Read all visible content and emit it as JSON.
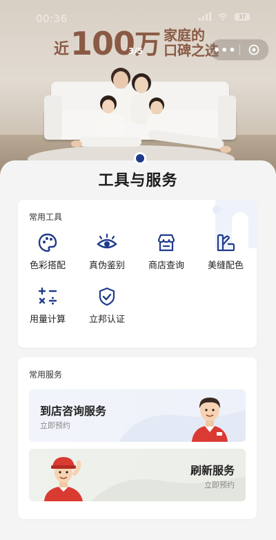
{
  "status_bar": {
    "time": "00:36",
    "battery": "37"
  },
  "banner": {
    "headline_prefix": "近",
    "headline_number": "100",
    "headline_unit": "万",
    "headline_line1": "家庭的",
    "headline_line2": "口碑之选",
    "pager": "3/5"
  },
  "page_title": "工具与服务",
  "tools_section": {
    "title": "常用工具",
    "items": [
      {
        "label": "色彩搭配",
        "icon": "palette-icon"
      },
      {
        "label": "真伪鉴别",
        "icon": "eye-icon"
      },
      {
        "label": "商店查询",
        "icon": "store-icon"
      },
      {
        "label": "美缝配色",
        "icon": "grout-color-icon"
      },
      {
        "label": "用量计算",
        "icon": "calculator-icon"
      },
      {
        "label": "立邦认证",
        "icon": "shield-check-icon"
      }
    ]
  },
  "services_section": {
    "title": "常用服务",
    "items": [
      {
        "title": "到店咨询服务",
        "subtitle": "立即预约"
      },
      {
        "title": "刷新服务",
        "subtitle": "立即预约"
      }
    ]
  },
  "colors": {
    "accent": "#1f3a8a",
    "headline": "#8a5a45"
  }
}
